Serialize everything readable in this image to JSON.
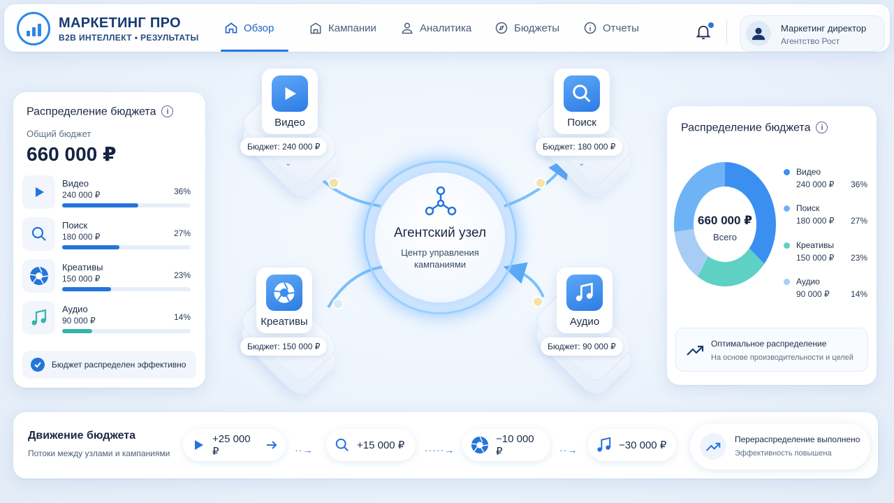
{
  "brand": {
    "title": "МАРКЕТИНГ ПРО",
    "subtitle": "B2B ИНТЕЛЛЕКТ • РЕЗУЛЬТАТЫ"
  },
  "nav": [
    {
      "label": "Обзор",
      "icon": "home-icon",
      "active": true
    },
    {
      "label": "Кампании",
      "icon": "building-icon"
    },
    {
      "label": "Аналитика",
      "icon": "user-icon"
    },
    {
      "label": "Бюджеты",
      "icon": "compass-icon"
    },
    {
      "label": "Отчеты",
      "icon": "info-icon"
    }
  ],
  "user": {
    "name": "Маркетинг директор",
    "org": "Агентство Рост"
  },
  "left": {
    "title": "Распределение бюджета",
    "total_label": "Общий бюджет",
    "total": "660 000 ₽",
    "rows": [
      {
        "name": "Видео",
        "amount": "240 000 ₽",
        "percent": "36%",
        "share": 36,
        "color": "#2474dc",
        "icon": "play-icon"
      },
      {
        "name": "Поиск",
        "amount": "180 000 ₽",
        "percent": "27%",
        "share": 27,
        "color": "#2474dc",
        "icon": "search-icon"
      },
      {
        "name": "Креативы",
        "amount": "150 000 ₽",
        "percent": "23%",
        "share": 23,
        "color": "#2474dc",
        "icon": "aperture-icon"
      },
      {
        "name": "Аудио",
        "amount": "90 000 ₽",
        "percent": "14%",
        "share": 14,
        "color": "#35b3ad",
        "icon": "music-icon"
      }
    ],
    "status": "Бюджет распределен эффективно"
  },
  "nodes": [
    {
      "name": "Видео",
      "budget": "Бюджет: 240 000 ₽",
      "icon": "play-icon"
    },
    {
      "name": "Поиск",
      "budget": "Бюджет: 180 000 ₽",
      "icon": "search-icon"
    },
    {
      "name": "Креативы",
      "budget": "Бюджет: 150 000 ₽",
      "icon": "aperture-icon"
    },
    {
      "name": "Аудио",
      "budget": "Бюджет: 90 000 ₽",
      "icon": "music-icon"
    }
  ],
  "hub": {
    "title": "Агентский узел",
    "subtitle": "Центр управления кампаниями",
    "icon": "network-icon"
  },
  "right": {
    "title": "Распределение бюджета",
    "donut_total": "660 000 ₽",
    "donut_label": "Всего",
    "legend": [
      {
        "name": "Видео",
        "amount": "240 000 ₽",
        "percent": "36%",
        "value": 36,
        "color": "#3b8ff0"
      },
      {
        "name": "Поиск",
        "amount": "180 000 ₽",
        "percent": "27%",
        "value": 27,
        "color": "#6fb3f7"
      },
      {
        "name": "Креативы",
        "amount": "150 000 ₽",
        "percent": "23%",
        "value": 23,
        "color": "#5fd0c4"
      },
      {
        "name": "Аудио",
        "amount": "90 000 ₽",
        "percent": "14%",
        "value": 14,
        "color": "#a8cdf5"
      }
    ],
    "opt_title": "Оптимальное распределение",
    "opt_sub": "На основе производительности и целей"
  },
  "bottom": {
    "title": "Движение бюджета",
    "subtitle": "Потоки между узлами и кампаниями",
    "flows": [
      {
        "value": "+25 000 ₽",
        "icon": "play-icon"
      },
      {
        "value": "+15 000 ₽",
        "icon": "search-icon"
      },
      {
        "value": "−10 000 ₽",
        "icon": "aperture-icon"
      },
      {
        "value": "−30 000 ₽",
        "icon": "music-icon"
      }
    ],
    "done_title": "Перераспределение выполнено",
    "done_sub": "Эффективность повышена"
  }
}
